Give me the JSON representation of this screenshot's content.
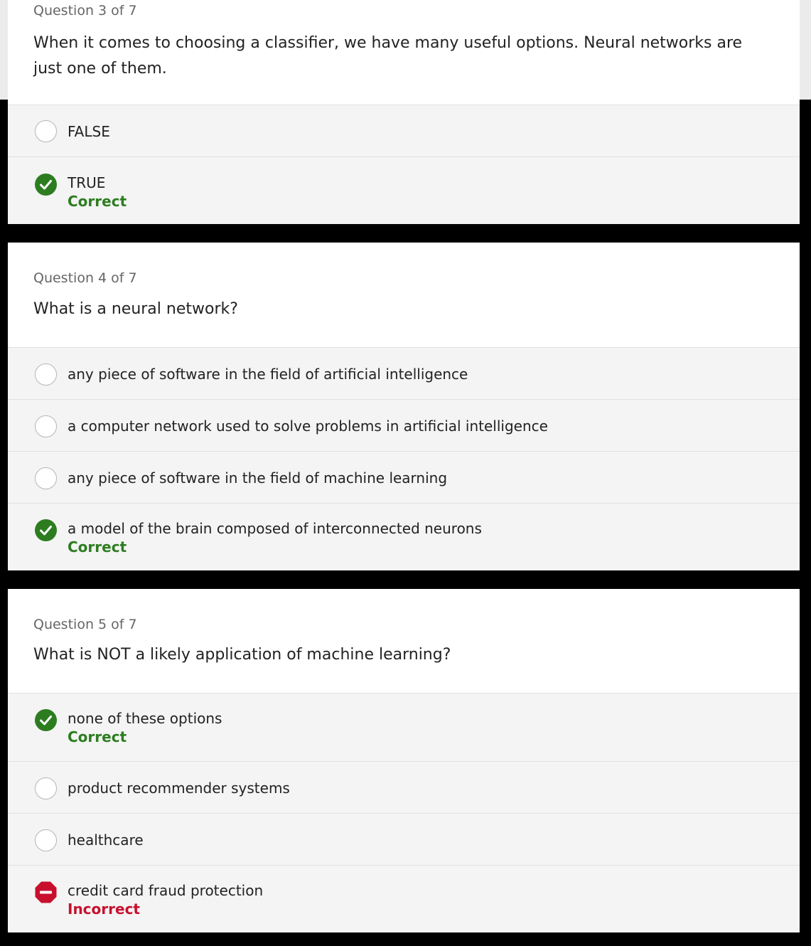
{
  "questions": [
    {
      "number_label": "Question 3 of 7",
      "text": "When it comes to choosing a classifier, we have many useful options. Neural networks are just one of them.",
      "options": [
        {
          "label": "FALSE",
          "state": "unselected"
        },
        {
          "label": "TRUE",
          "state": "correct",
          "verdict": "Correct"
        }
      ]
    },
    {
      "number_label": "Question 4 of 7",
      "text": "What is a neural network?",
      "options": [
        {
          "label": "any piece of software in the field of artificial intelligence",
          "state": "unselected"
        },
        {
          "label": "a computer network used to solve problems in artificial intelligence",
          "state": "unselected"
        },
        {
          "label": "any piece of software in the field of machine learning",
          "state": "unselected"
        },
        {
          "label": "a model of the brain composed of interconnected neurons",
          "state": "correct",
          "verdict": "Correct"
        }
      ]
    },
    {
      "number_label": "Question 5 of 7",
      "text": "What is NOT a likely application of machine learning?",
      "options": [
        {
          "label": "none of these options",
          "state": "correct",
          "verdict": "Correct"
        },
        {
          "label": "product recommender systems",
          "state": "unselected"
        },
        {
          "label": "healthcare",
          "state": "unselected"
        },
        {
          "label": "credit card fraud protection",
          "state": "incorrect",
          "verdict": "Incorrect"
        }
      ]
    }
  ],
  "icons": {
    "correct": "check-circle-icon",
    "incorrect": "minus-circle-icon",
    "unselected": "radio-circle"
  },
  "colors": {
    "correct_green": "#2d7d20",
    "incorrect_red": "#c8102e"
  }
}
